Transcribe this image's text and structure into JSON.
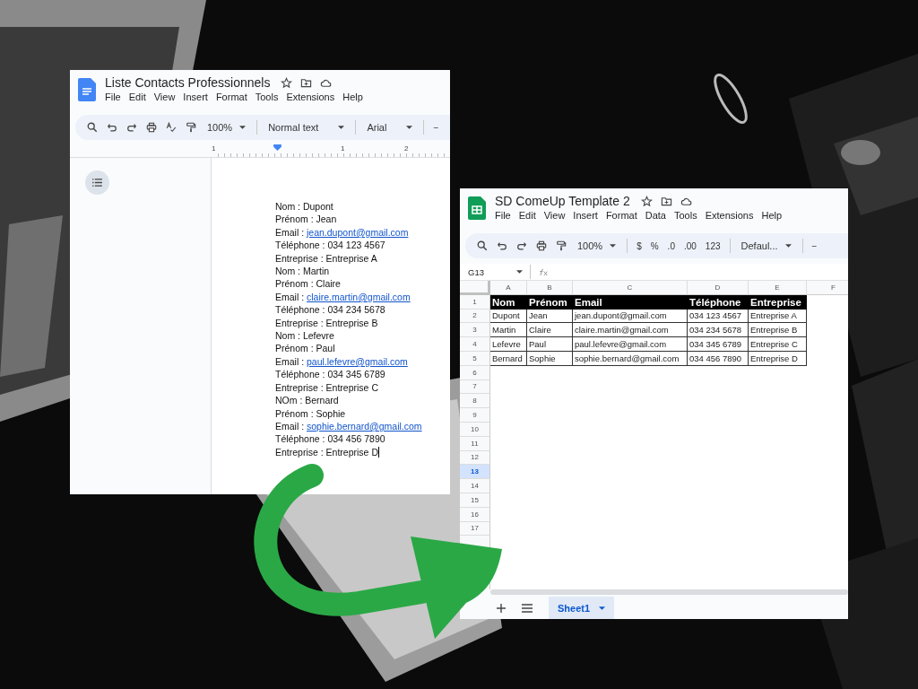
{
  "docs": {
    "title": "Liste Contacts Professionnels",
    "menu": [
      "File",
      "Edit",
      "View",
      "Insert",
      "Format",
      "Tools",
      "Extensions",
      "Help"
    ],
    "toolbar": [
      {
        "kind": "search"
      },
      {
        "kind": "undo"
      },
      {
        "kind": "redo"
      },
      {
        "kind": "print"
      },
      {
        "kind": "spellcheck"
      },
      {
        "kind": "paint"
      },
      {
        "kind": "select",
        "label": "100%"
      },
      {
        "kind": "separator"
      },
      {
        "kind": "select",
        "label": "Normal text"
      },
      {
        "kind": "separator"
      },
      {
        "kind": "select",
        "label": "Arial"
      },
      {
        "kind": "separator"
      },
      {
        "kind": "text",
        "label": "−"
      }
    ],
    "ruler": [
      "1",
      "1",
      "2"
    ],
    "lines": [
      {
        "kind": "plain",
        "text": "Nom : Dupont",
        "cursor": false
      },
      {
        "kind": "plain",
        "text": "Prénom : Jean",
        "cursor": false
      },
      {
        "kind": "link",
        "text": "Email : ",
        "link": "jean.dupont@gmail.com",
        "cursor": false
      },
      {
        "kind": "plain",
        "text": "Téléphone : 034 123 4567",
        "cursor": false
      },
      {
        "kind": "plain",
        "text": "Entreprise : Entreprise A",
        "cursor": false
      },
      {
        "kind": "plain",
        "text": "Nom : Martin",
        "cursor": false
      },
      {
        "kind": "plain",
        "text": "Prénom : Claire",
        "cursor": false
      },
      {
        "kind": "link",
        "text": "Email : ",
        "link": "claire.martin@gmail.com",
        "cursor": false
      },
      {
        "kind": "plain",
        "text": "Téléphone : 034 234 5678",
        "cursor": false
      },
      {
        "kind": "plain",
        "text": "Entreprise : Entreprise B",
        "cursor": false
      },
      {
        "kind": "plain",
        "text": "Nom : Lefevre",
        "cursor": false
      },
      {
        "kind": "plain",
        "text": "Prénom : Paul",
        "cursor": false
      },
      {
        "kind": "link",
        "text": "Email : ",
        "link": "paul.lefevre@gmail.com",
        "cursor": false
      },
      {
        "kind": "plain",
        "text": "Téléphone : 034 345 6789",
        "cursor": false
      },
      {
        "kind": "plain",
        "text": "Entreprise : Entreprise C",
        "cursor": false
      },
      {
        "kind": "plain",
        "text": "NOm : Bernard",
        "cursor": false
      },
      {
        "kind": "plain",
        "text": "Prénom : Sophie",
        "cursor": false
      },
      {
        "kind": "link",
        "text": "Email : ",
        "link": "sophie.bernard@gmail.com",
        "cursor": false
      },
      {
        "kind": "plain",
        "text": "Téléphone : 034 456 7890",
        "cursor": false
      },
      {
        "kind": "plain",
        "text": "Entreprise : Entreprise D",
        "cursor": true
      }
    ]
  },
  "sheets": {
    "title": "SD ComeUp Template 2",
    "menu": [
      "File",
      "Edit",
      "View",
      "Insert",
      "Format",
      "Data",
      "Tools",
      "Extensions",
      "Help"
    ],
    "toolbar": [
      {
        "kind": "search"
      },
      {
        "kind": "undo"
      },
      {
        "kind": "redo"
      },
      {
        "kind": "print"
      },
      {
        "kind": "paint"
      },
      {
        "kind": "select",
        "label": "100%"
      },
      {
        "kind": "separator"
      },
      {
        "kind": "text",
        "label": "$"
      },
      {
        "kind": "text",
        "label": "%"
      },
      {
        "kind": "text",
        "label": ".0"
      },
      {
        "kind": "text",
        "label": ".00"
      },
      {
        "kind": "text",
        "label": "123"
      },
      {
        "kind": "separator"
      },
      {
        "kind": "select",
        "label": "Defaul..."
      },
      {
        "kind": "separator"
      },
      {
        "kind": "text",
        "label": "−"
      }
    ],
    "name_box": "G13",
    "columns": [
      "A",
      "B",
      "C",
      "D",
      "E",
      "F"
    ],
    "header": [
      "Nom",
      "Prénom",
      "Email",
      "Téléphone",
      "Entreprise"
    ],
    "rows": [
      [
        "Dupont",
        "Jean",
        "jean.dupont@gmail.com",
        "034 123 4567",
        "Entreprise A"
      ],
      [
        "Martin",
        "Claire",
        "claire.martin@gmail.com",
        "034 234 5678",
        "Entreprise B"
      ],
      [
        "Lefevre",
        "Paul",
        "paul.lefevre@gmail.com",
        "034 345 6789",
        "Entreprise C"
      ],
      [
        "Bernard",
        "Sophie",
        "sophie.bernard@gmail.com",
        "034 456 7890",
        "Entreprise D"
      ]
    ],
    "row_numbers": [
      {
        "label": "1",
        "selected": false
      },
      {
        "label": "2",
        "selected": false
      },
      {
        "label": "3",
        "selected": false
      },
      {
        "label": "4",
        "selected": false
      },
      {
        "label": "5",
        "selected": false
      },
      {
        "label": "6",
        "selected": false
      },
      {
        "label": "7",
        "selected": false
      },
      {
        "label": "8",
        "selected": false
      },
      {
        "label": "9",
        "selected": false
      },
      {
        "label": "10",
        "selected": false
      },
      {
        "label": "11",
        "selected": false
      },
      {
        "label": "12",
        "selected": false
      },
      {
        "label": "13",
        "selected": true
      },
      {
        "label": "14",
        "selected": false
      },
      {
        "label": "15",
        "selected": false
      },
      {
        "label": "16",
        "selected": false
      },
      {
        "label": "17",
        "selected": false
      }
    ],
    "sheet_tabs": [
      {
        "label": "Sheet1",
        "selected": true
      }
    ]
  }
}
